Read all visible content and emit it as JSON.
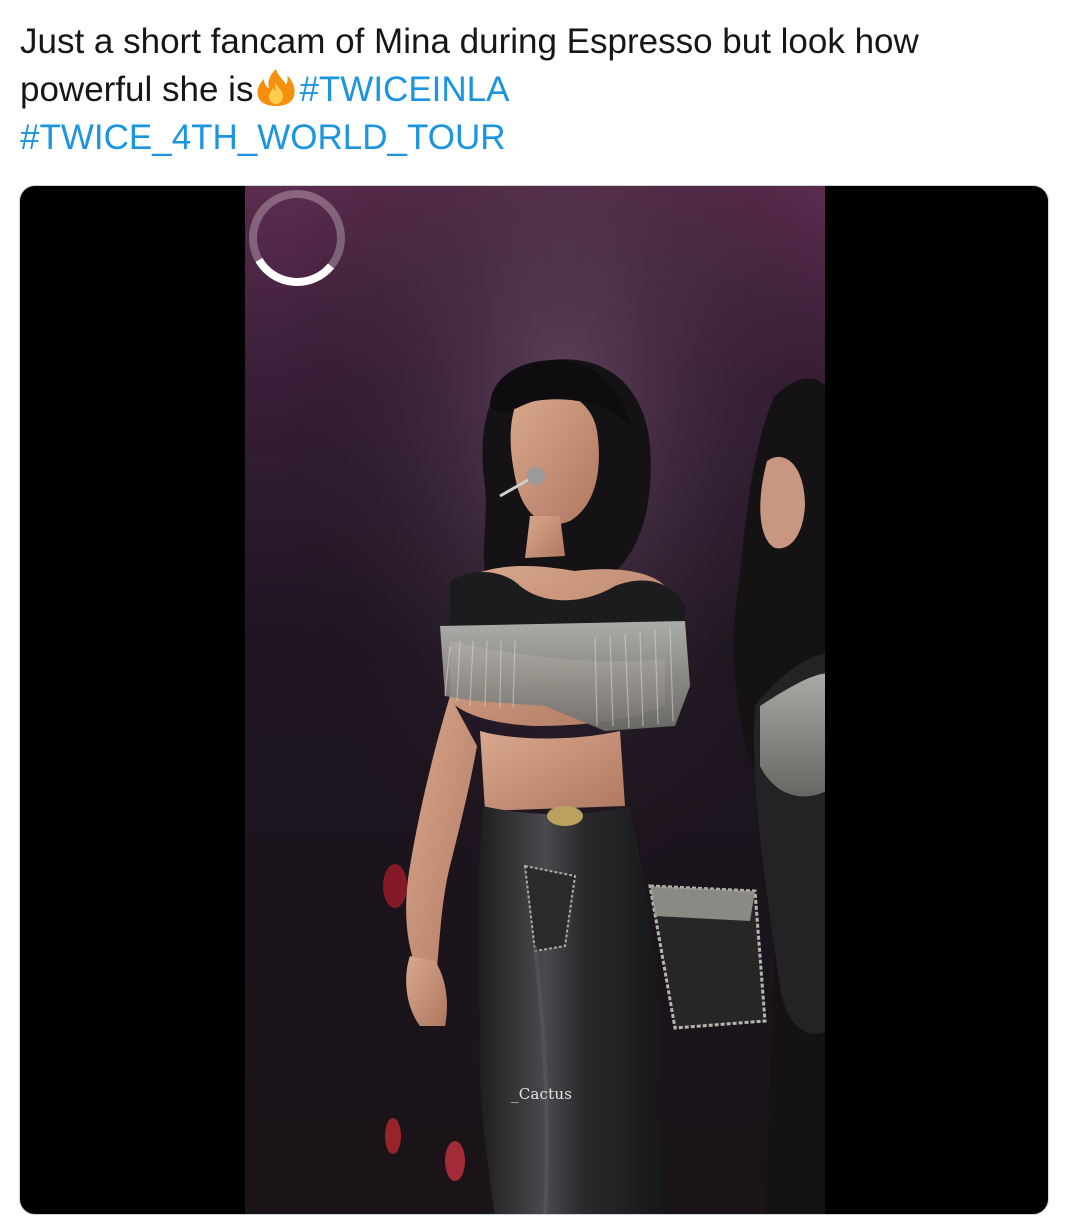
{
  "tweet": {
    "text_line1": "Just a short fancam of Mina during Espresso but look how",
    "text_line2_prefix": "powerful she is",
    "emoji": "fire-icon",
    "hashtags": [
      "#TWICEINLA",
      "#TWICE_4TH_WORLD_TOUR"
    ]
  },
  "media": {
    "type": "video",
    "watermark": "_Cactus",
    "state": "loading",
    "loading_icon": "spinner-icon"
  },
  "colors": {
    "text": "#14171a",
    "hashtag": "#1b95e0",
    "card_border": "#ccd6dd",
    "letterbox": "#000000"
  }
}
